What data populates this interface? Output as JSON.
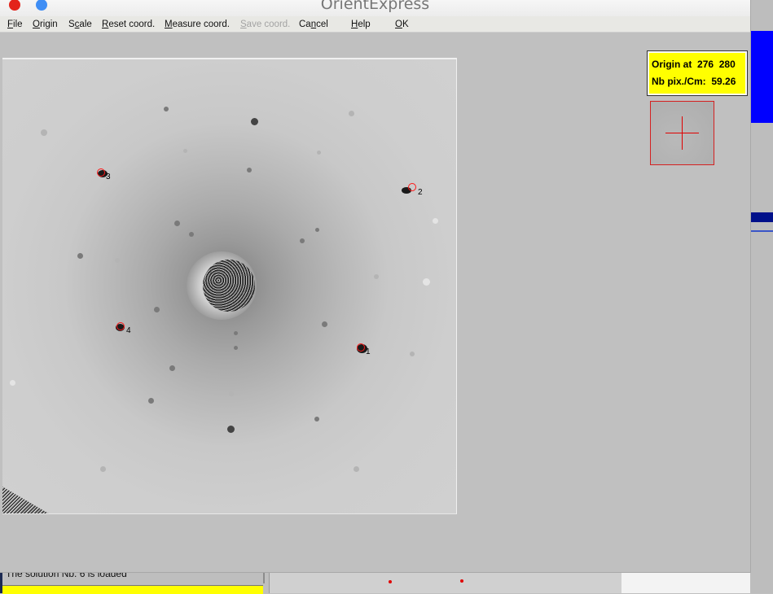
{
  "window": {
    "title": "OrientExpress"
  },
  "menu": [
    {
      "name": "menu-file",
      "label": "File",
      "mnemonic_index": 0,
      "enabled": true
    },
    {
      "name": "menu-origin",
      "label": "Origin",
      "mnemonic_index": 0,
      "enabled": true
    },
    {
      "name": "menu-scale",
      "label": "Scale",
      "mnemonic_index": 1,
      "enabled": true
    },
    {
      "name": "menu-reset-coord",
      "label": "Reset coord.",
      "mnemonic_index": 0,
      "enabled": true
    },
    {
      "name": "menu-measure-coord",
      "label": "Measure coord.",
      "mnemonic_index": 0,
      "enabled": true
    },
    {
      "name": "menu-save-coord",
      "label": "Save coord.",
      "mnemonic_index": 0,
      "enabled": false
    },
    {
      "name": "menu-cancel",
      "label": "Cancel",
      "mnemonic_index": 2,
      "enabled": true
    },
    {
      "name": "menu-help",
      "label": "Help",
      "mnemonic_index": 0,
      "enabled": true
    },
    {
      "name": "menu-ok",
      "label": "OK",
      "mnemonic_index": 0,
      "enabled": true
    }
  ],
  "info": {
    "origin_label": "Origin at",
    "origin_x": "276",
    "origin_y": "280",
    "scale_label": "Nb pix./Cm:",
    "scale_value": "59.26"
  },
  "markers": [
    {
      "label": "1"
    },
    {
      "label": "2"
    },
    {
      "label": "3"
    },
    {
      "label": "4"
    }
  ],
  "status": {
    "message": "The solution Nb. 6 is loaded"
  },
  "colors": {
    "marker": "#ff1818",
    "info_background": "#ffff00",
    "crosshair": "#e00000"
  }
}
